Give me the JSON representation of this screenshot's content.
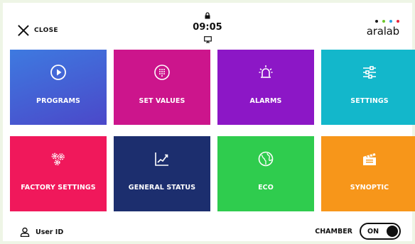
{
  "header": {
    "close_label": "CLOSE",
    "time": "09:05",
    "brand": "aralab",
    "brand_dot_colors": [
      "#1a1a1a",
      "#6ec72c",
      "#2aa3e0",
      "#e8263f"
    ]
  },
  "tiles": [
    {
      "label": "PROGRAMS",
      "icon": "play-icon",
      "color": "linear-gradient(160deg,#3e7ae0,#4b48c9)"
    },
    {
      "label": "SET VALUES",
      "icon": "keypad-icon",
      "color": "#cc158c"
    },
    {
      "label": "ALARMS",
      "icon": "alarm-icon",
      "color": "#8c17c6"
    },
    {
      "label": "SETTINGS",
      "icon": "sliders-icon",
      "color": "#13b7cb"
    },
    {
      "label": "FACTORY SETTINGS",
      "icon": "gears-icon",
      "color": "#f0185b"
    },
    {
      "label": "GENERAL STATUS",
      "icon": "chart-icon",
      "color": "#1c2e6e"
    },
    {
      "label": "ECO",
      "icon": "globe-icon",
      "color": "#2fcc4e"
    },
    {
      "label": "SYNOPTIC",
      "icon": "clapper-icon",
      "color": "#f7961a"
    }
  ],
  "footer": {
    "user_label": "User ID",
    "chamber_label": "CHAMBER",
    "toggle_state": "ON"
  }
}
